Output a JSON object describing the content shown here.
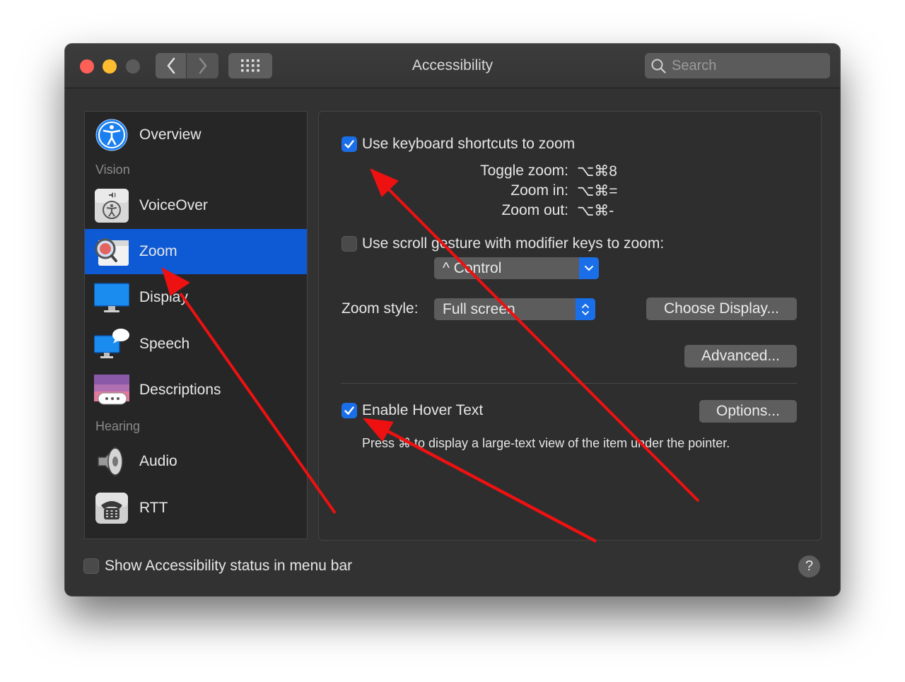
{
  "window": {
    "title": "Accessibility",
    "search_placeholder": "Search"
  },
  "toolbar": {
    "back_icon": "chevron-left-icon",
    "forward_icon": "chevron-right-icon",
    "grid_icon": "grid-icon"
  },
  "sidebar": {
    "items": [
      {
        "label": "Overview",
        "icon": "accessibility-icon"
      },
      {
        "label": "VoiceOver",
        "icon": "voiceover-icon"
      },
      {
        "label": "Zoom",
        "icon": "zoom-icon",
        "selected": true
      },
      {
        "label": "Display",
        "icon": "display-icon"
      },
      {
        "label": "Speech",
        "icon": "speech-icon"
      },
      {
        "label": "Descriptions",
        "icon": "descriptions-icon"
      },
      {
        "label": "Audio",
        "icon": "speaker-icon"
      },
      {
        "label": "RTT",
        "icon": "telephone-icon"
      }
    ],
    "headings": {
      "vision": "Vision",
      "hearing": "Hearing"
    }
  },
  "zoom": {
    "keyboard_shortcuts": {
      "label": "Use keyboard shortcuts to zoom",
      "checked": true,
      "shortcuts": [
        {
          "name": "Toggle zoom:",
          "keys": "⌥⌘8"
        },
        {
          "name": "Zoom in:",
          "keys": "⌥⌘="
        },
        {
          "name": "Zoom out:",
          "keys": "⌥⌘-"
        }
      ]
    },
    "scroll_gesture": {
      "label": "Use scroll gesture with modifier keys to zoom:",
      "checked": false,
      "modifier": "^ Control"
    },
    "zoom_style": {
      "label": "Zoom style:",
      "value": "Full screen"
    },
    "choose_display_label": "Choose Display...",
    "advanced_label": "Advanced...",
    "hover_text": {
      "label": "Enable Hover Text",
      "checked": true,
      "options_label": "Options...",
      "hint": "Press ⌘ to display a large-text view of the item under the pointer."
    }
  },
  "footer": {
    "status_label": "Show Accessibility status in menu bar",
    "status_checked": false,
    "help_label": "?"
  },
  "colors": {
    "accent": "#1a6fe8",
    "selection": "#0e5ad5",
    "annotation": "#ff0000"
  }
}
